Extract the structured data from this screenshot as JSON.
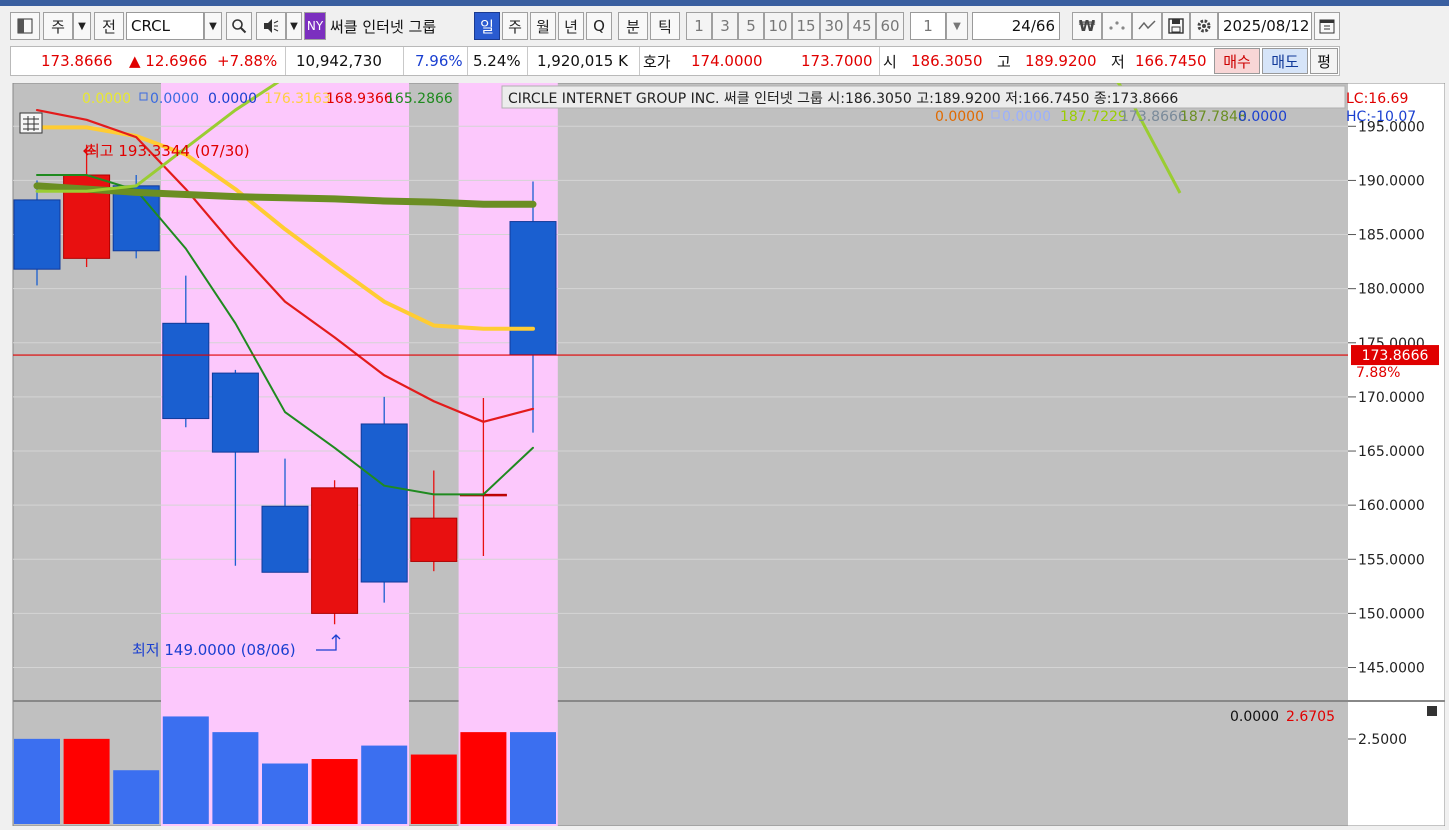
{
  "toolbar": {
    "type_label": "주",
    "view_label": "전",
    "symbol": "CRCL",
    "ny_label": "NY",
    "stock_name": "써클 인터넷 그룹",
    "period_day": "일",
    "period_week": "주",
    "period_month": "월",
    "period_year": "년",
    "period_q": "Q",
    "period_min": "분",
    "period_tick": "틱",
    "intervals": [
      "1",
      "3",
      "5",
      "10",
      "15",
      "30",
      "45",
      "60"
    ],
    "count": "1",
    "page": "24",
    "page_total": "/66",
    "date": "2025/08/12",
    "won_icon": "₩"
  },
  "quote": {
    "price": "173.8666",
    "change": "▲ 12.6966",
    "change_pct": "+7.88%",
    "volume": "10,942,730",
    "pct1": "7.96%",
    "pct2": "5.24%",
    "amount": "1,920,015 K",
    "hoga_label": "호가",
    "ask": "174.0000",
    "bid": "173.7000",
    "open_label": "시",
    "open": "186.3050",
    "high_label": "고",
    "high": "189.9200",
    "low_label": "저",
    "low": "166.7450",
    "buy_label": "매수",
    "sell_label": "매도",
    "avg_label": "평"
  },
  "chart": {
    "legend_left": [
      "0.0000",
      "0.0000",
      "0.0000",
      "176.3163",
      "168.9366",
      "165.2866"
    ],
    "legend_colors": [
      "#e8e830",
      "#3a6ae0",
      "#1a3fd0",
      "#ffcf40",
      "#e00000",
      "#1f8a1f"
    ],
    "title_info": "CIRCLE INTERNET GROUP INC.  써클 인터넷 그룹 시:186.3050 고:189.9200 저:166.7450 종:173.8666",
    "legend_right": [
      "0.0000",
      "0.0000",
      "187.7229",
      "173.8666",
      "187.7848",
      "0.0000"
    ],
    "legend_right_colors": [
      "#e06a00",
      "#9ab0ff",
      "#9acd00",
      "#7a8a9a",
      "#6b8e23",
      "#1a3fd0"
    ],
    "lc": "LC:16.69",
    "hc": "HC:-10.07",
    "high_annot": "최고 193.3344 (07/30)",
    "low_annot": "최저 149.0000 (08/06)",
    "current_label": "173.8666",
    "current_pct": "7.88%",
    "y_ticks": [
      "195.0000",
      "190.0000",
      "185.0000",
      "180.0000",
      "175.0000",
      "170.0000",
      "165.0000",
      "160.0000",
      "155.0000",
      "150.0000",
      "145.0000"
    ],
    "vol_legend_a": "0.0000",
    "vol_legend_b": "2.6705",
    "vol_tick": "2.5000",
    "colors": {
      "up": "#e81010",
      "down": "#1a5fd0",
      "bg": "#c0c0c0",
      "highlight": "#fcc8fc"
    }
  },
  "chart_data": {
    "type": "candlestick",
    "y_range": [
      142,
      199
    ],
    "y_ticks": [
      195,
      190,
      185,
      180,
      175,
      170,
      165,
      160,
      155,
      150,
      145
    ],
    "candles": [
      {
        "open": 188.2,
        "close": 181.8,
        "high": 190.0,
        "low": 180.3,
        "dir": "down",
        "highlight": false
      },
      {
        "open": 182.8,
        "close": 190.5,
        "high": 193.3,
        "low": 182.0,
        "dir": "up",
        "highlight": false
      },
      {
        "open": 189.5,
        "close": 183.5,
        "high": 190.5,
        "low": 182.8,
        "dir": "down",
        "highlight": false
      },
      {
        "open": 176.8,
        "close": 168.0,
        "high": 181.2,
        "low": 167.2,
        "dir": "down",
        "highlight": true
      },
      {
        "open": 172.2,
        "close": 164.9,
        "high": 172.5,
        "low": 154.4,
        "dir": "down",
        "highlight": true
      },
      {
        "open": 159.9,
        "close": 153.8,
        "high": 164.3,
        "low": 153.8,
        "dir": "down",
        "highlight": true
      },
      {
        "open": 150.0,
        "close": 161.6,
        "high": 162.3,
        "low": 149.0,
        "dir": "up",
        "highlight": true
      },
      {
        "open": 167.5,
        "close": 152.9,
        "high": 170.0,
        "low": 151.0,
        "dir": "down",
        "highlight": true
      },
      {
        "open": 154.8,
        "close": 158.8,
        "high": 163.2,
        "low": 153.9,
        "dir": "up",
        "highlight": false
      },
      {
        "open": 160.9,
        "close": 161.0,
        "high": 169.9,
        "low": 155.3,
        "dir": "up",
        "highlight": true
      },
      {
        "open": 186.2,
        "close": 173.9,
        "high": 189.9,
        "low": 166.7,
        "dir": "down",
        "highlight": true
      }
    ],
    "ma_lines": [
      {
        "name": "MA20",
        "color": "#ffcc33",
        "values": [
          194.9,
          194.9,
          194.1,
          192.4,
          189.2,
          185.5,
          182.1,
          178.8,
          176.6,
          176.3,
          176.3
        ]
      },
      {
        "name": "MA10",
        "color": "#e31b1b",
        "values": [
          196.5,
          195.6,
          194.0,
          189.2,
          183.8,
          178.8,
          175.5,
          172.0,
          169.6,
          167.7,
          168.9
        ]
      },
      {
        "name": "MA5",
        "color": "#1f8a1f",
        "values": [
          190.5,
          190.5,
          189.1,
          183.7,
          176.8,
          168.6,
          165.3,
          161.8,
          161.0,
          161.0,
          165.3
        ]
      },
      {
        "name": "Trend",
        "color": "#6b8e23",
        "values": [
          189.5,
          189.2,
          188.9,
          188.7,
          188.5,
          188.4,
          188.3,
          188.1,
          188.0,
          187.8,
          187.8
        ]
      },
      {
        "name": "Projection",
        "color": "#9acd32",
        "values": [
          189.0,
          189.0,
          189.5,
          193.0,
          196.5,
          199.5,
          201.0,
          201.0,
          201.0,
          201.0,
          201.0
        ]
      }
    ],
    "volume_bars": [
      {
        "value": 1.9,
        "dir": "down"
      },
      {
        "value": 1.9,
        "dir": "up"
      },
      {
        "value": 1.2,
        "dir": "down"
      },
      {
        "value": 2.4,
        "dir": "down"
      },
      {
        "value": 2.05,
        "dir": "down"
      },
      {
        "value": 1.35,
        "dir": "down"
      },
      {
        "value": 1.45,
        "dir": "up"
      },
      {
        "value": 1.75,
        "dir": "down"
      },
      {
        "value": 1.55,
        "dir": "up"
      },
      {
        "value": 2.05,
        "dir": "up"
      },
      {
        "value": 2.05,
        "dir": "down"
      }
    ]
  }
}
